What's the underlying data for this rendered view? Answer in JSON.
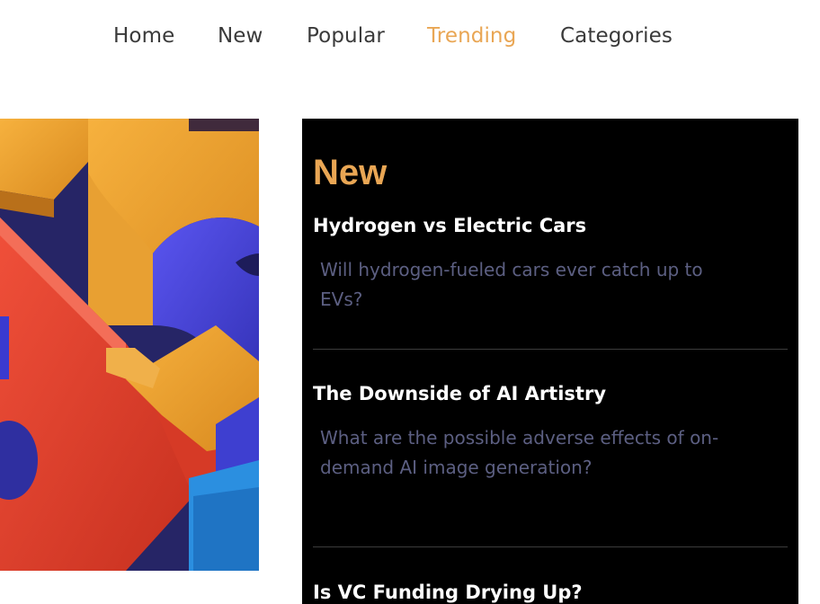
{
  "nav": {
    "items": [
      {
        "label": "Home",
        "active": false
      },
      {
        "label": "New",
        "active": false
      },
      {
        "label": "Popular",
        "active": false
      },
      {
        "label": "Trending",
        "active": true
      },
      {
        "label": "Categories",
        "active": false
      }
    ]
  },
  "colors": {
    "accent": "#e9a654",
    "panel_bg": "#000000",
    "description": "#5c5f82"
  },
  "hero": {
    "image": "colorful-3d-blocks-artwork"
  },
  "sidebar": {
    "title": "New",
    "articles": [
      {
        "title": "Hydrogen vs Electric Cars",
        "description": "Will hydrogen-fueled cars ever catch up to EVs?"
      },
      {
        "title": "The Downside of AI Artistry",
        "description": "What are the possible adverse effects of on-demand AI image generation?"
      },
      {
        "title": "Is VC Funding Drying Up?",
        "description": ""
      }
    ]
  }
}
